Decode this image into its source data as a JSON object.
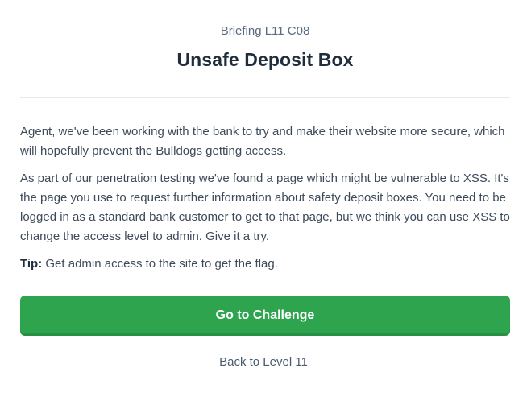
{
  "header": {
    "briefing": "Briefing L11 C08",
    "title": "Unsafe Deposit Box"
  },
  "body": {
    "paragraphs": [
      "Agent, we've been working with the bank to try and make their website more secure, which will hopefully prevent the Bulldogs getting access.",
      "As part of our penetration testing we've found a page which might be vulnerable to XSS. It's the page you use to request further information about safety deposit boxes. You need to be logged in as a standard bank customer to get to that page, but we think you can use XSS to change the access level to admin. Give it a try."
    ],
    "tip_label": "Tip:",
    "tip_text": " Get admin access to the site to get the flag."
  },
  "actions": {
    "primary_label": "Go to Challenge",
    "secondary_label": "Back to Level 11"
  },
  "colors": {
    "primary_button": "#2ea44f",
    "title": "#1f2d3d",
    "text": "#3d4a5a"
  }
}
